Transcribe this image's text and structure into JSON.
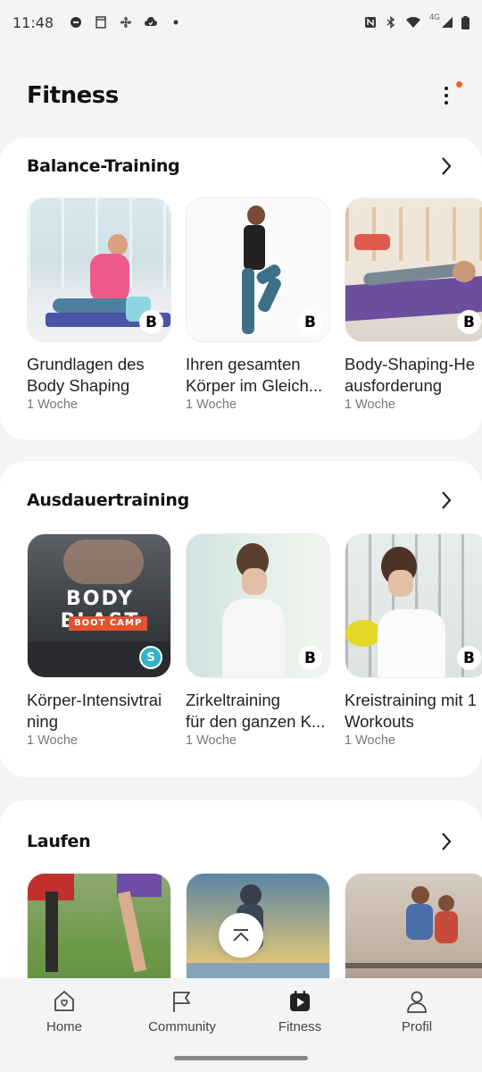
{
  "status_bar": {
    "time": "11:48",
    "network_type": "4G"
  },
  "header": {
    "title": "Fitness"
  },
  "sections": [
    {
      "title": "Balance-Training",
      "items": [
        {
          "title_line1": "Grundlagen des",
          "title_line2": "Body Shaping",
          "duration": "1 Woche",
          "badge": "B"
        },
        {
          "title_line1": "Ihren gesamten",
          "title_line2": "Körper im Gleich...",
          "duration": "1 Woche",
          "badge": "B"
        },
        {
          "title_line1": "Body-Shaping-He",
          "title_line2": "ausforderung",
          "duration": "1 Woche",
          "badge": "B"
        }
      ]
    },
    {
      "title": "Ausdauertraining",
      "items": [
        {
          "title_line1": "Körper-Intensivtrai",
          "title_line2": "ning",
          "duration": "1 Woche",
          "badge": "S",
          "thumb_text1": "BODY BLAST",
          "thumb_text2": "BOOT CAMP"
        },
        {
          "title_line1": "Zirkeltraining",
          "title_line2": "für den ganzen K...",
          "duration": "1 Woche",
          "badge": "B"
        },
        {
          "title_line1": "Kreistraining mit 1",
          "title_line2": "Workouts",
          "duration": "1 Woche",
          "badge": "B"
        }
      ]
    },
    {
      "title": "Laufen"
    }
  ],
  "nav": {
    "home": "Home",
    "community": "Community",
    "fitness": "Fitness",
    "profile": "Profil"
  },
  "colors": {
    "accent_dot": "#f0642b",
    "badge_s": "#2fb5c6"
  }
}
